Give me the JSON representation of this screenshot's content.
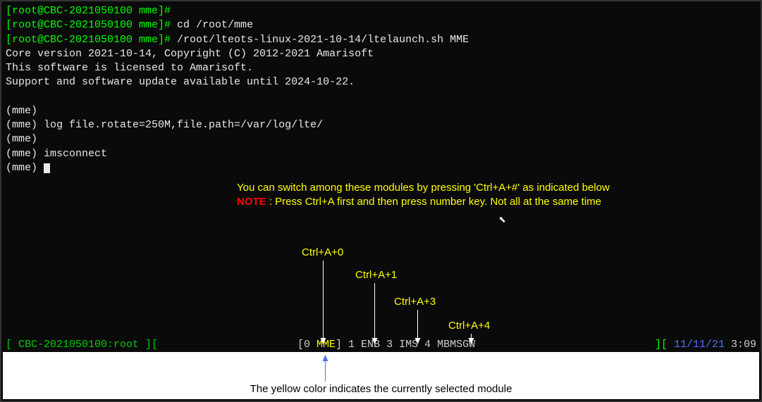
{
  "term": {
    "l1": "[root@CBC-2021050100 mme]#",
    "l2p": "[root@CBC-2021050100 mme]# ",
    "l2c": "cd /root/mme",
    "l3p": "[root@CBC-2021050100 mme]# ",
    "l3c": "/root/lteots-linux-2021-10-14/ltelaunch.sh MME",
    "l4": "Core version 2021-10-14, Copyright (C) 2012-2021 Amarisoft",
    "l5": "This software is licensed to Amarisoft.",
    "l6": "Support and software update available until 2024-10-22.",
    "l8": "(mme)",
    "l9": "(mme) log file.rotate=250M,file.path=/var/log/lte/",
    "l10": "(mme)",
    "l11": "(mme) imsconnect",
    "l12": "(mme) "
  },
  "instr": {
    "line1": "You can switch among these modules by pressing 'Ctrl+A+#' as indicated below",
    "note_label": "NOTE",
    "line2": " : Press Ctrl+A first and then press number key. Not all at the same time"
  },
  "hotkeys": {
    "k0": "Ctrl+A+0",
    "k1": "Ctrl+A+1",
    "k3": "Ctrl+A+3",
    "k4": "Ctrl+A+4"
  },
  "status": {
    "host": "CBC-2021050100:root",
    "lbracket": "[ ",
    "rbracket": " ][",
    "tab0n": "[0 ",
    "tab0l": "MME",
    "tab0c": "]",
    "tab1": "  1 ENB",
    "tab3": "  3 IMS",
    "tab4": "  4 MBMSGW",
    "date": "11/11/21",
    "time": "3:09",
    "rbracket2": "][ "
  },
  "caption": "The yellow color indicates the currently selected module"
}
